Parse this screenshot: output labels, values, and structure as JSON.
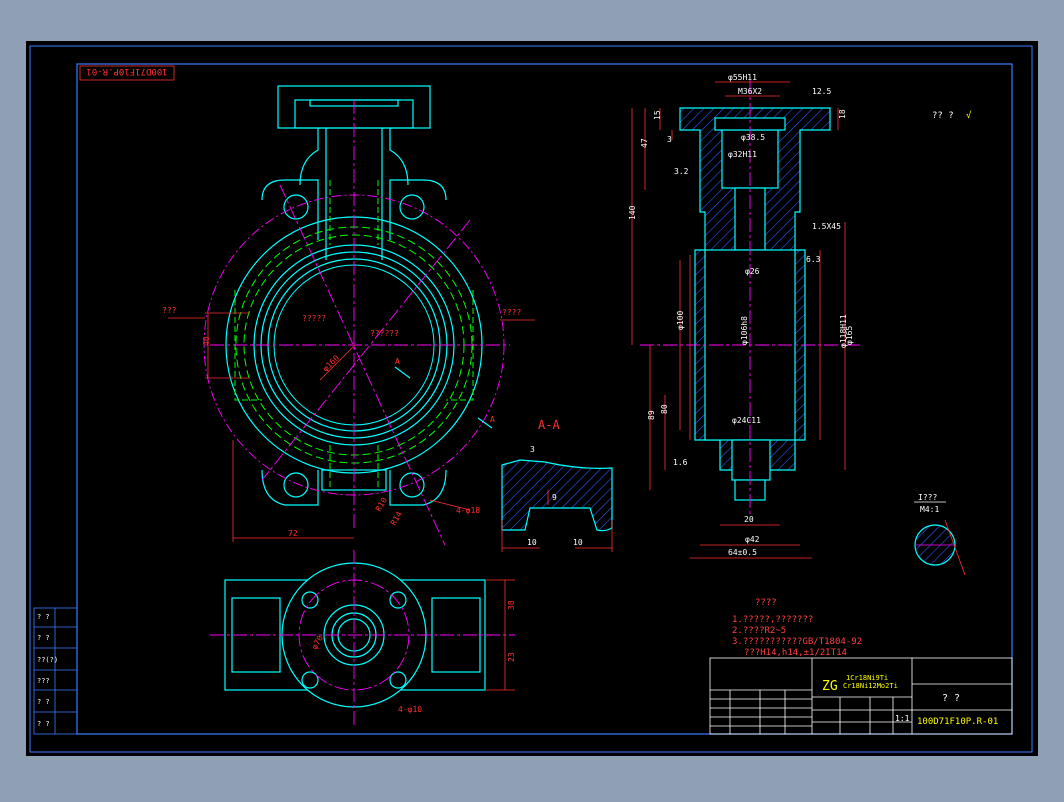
{
  "colors": {
    "frame": "#3a7cff",
    "outline": "#00ffff",
    "center": "#ff00ff",
    "dim": "#ff3030",
    "hidden": "#00ff00",
    "note": "#ff4040",
    "white": "#ffffff",
    "yellow": "#ffff00",
    "background": "#000000",
    "hatch": "#2255ff"
  },
  "drawing": {
    "code_rotated": "100D71F10P.R-01",
    "code_block": "100D71F10P.R-01",
    "section_label": "A-A",
    "section_arrow_label": "A",
    "section_arrow_label2": "A",
    "detail_label": "I???",
    "detail_scale": "M4:1",
    "title_cell": "? ?",
    "scale_value": "1:1"
  },
  "front_view": {
    "left_tag": "???",
    "right_tag": "????",
    "center_tag": "?????",
    "center_tag2": "??????",
    "dim_72": "72",
    "dim_40": "40",
    "dim_phi": "φ160",
    "dim_r10": "R10",
    "dim_r14": "R14",
    "holes": "4-φ18"
  },
  "section_detail": {
    "dim_left": "10",
    "dim_right": "10",
    "dim_small": "3",
    "dim_mid": "9"
  },
  "side_view": {
    "dim_top": "φ55H11",
    "dim_thread": "M36X2",
    "dim_bore1": "φ38.5",
    "dim_bore2": "φ32H11",
    "dim_26": "φ26",
    "dim_100": "φ100",
    "dim_106": "φ106h8",
    "dim_118": "φ118H11",
    "dim_165": "φ165",
    "dim_24": "φ24C11",
    "dim_20": "20",
    "dim_42": "φ42",
    "dim_64": "64±0.5",
    "dim_140": "140",
    "dim_47": "47",
    "dim_15": "15",
    "dim_3": "3",
    "dim_89": "89",
    "dim_80": "80",
    "dim_chamfer": "1.5X45",
    "dim_18": "18",
    "rough_125": "12.5",
    "rough_32": "3.2",
    "rough_63": "6.3",
    "rough_16": "1.6"
  },
  "bottom_view": {
    "dim_30": "30",
    "dim_23": "23",
    "dim_phi70": "φ70",
    "holes": "4-φ10"
  },
  "notes": {
    "title": "????",
    "line1": "1.?????,???????",
    "line2": "2.????R2~5",
    "line3": "3.???????????GB/T1804-92",
    "line4": "???H14,h14,±1/2IT14"
  },
  "title_block": {
    "material_big": "ZG",
    "material_line1": "1Cr18Ni9Ti",
    "material_line2": "Cr18Ni12Mo2Ti",
    "left_rows": [
      "? ?",
      "? ?",
      "??(?)",
      "???",
      "? ?",
      "? ?"
    ],
    "marks": "??  ?",
    "roughness_mark": "√"
  }
}
